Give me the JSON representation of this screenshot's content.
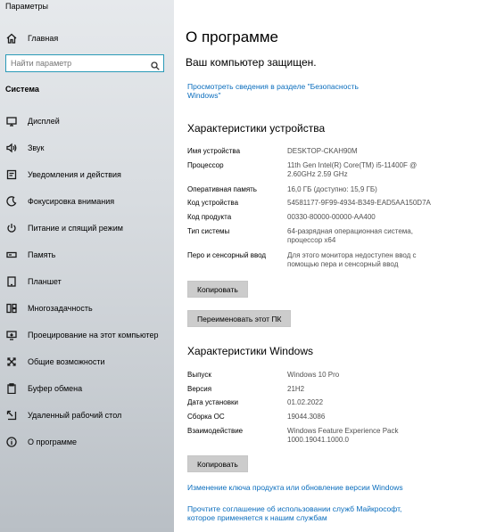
{
  "window": {
    "title": "Параметры"
  },
  "sidebar": {
    "home_label": "Главная",
    "search_placeholder": "Найти параметр",
    "section_label": "Система",
    "items": [
      {
        "label": "Дисплей",
        "icon": "display-icon"
      },
      {
        "label": "Звук",
        "icon": "speaker-icon"
      },
      {
        "label": "Уведомления и действия",
        "icon": "notifications-icon"
      },
      {
        "label": "Фокусировка внимания",
        "icon": "focus-assist-icon"
      },
      {
        "label": "Питание и спящий режим",
        "icon": "power-icon"
      },
      {
        "label": "Память",
        "icon": "storage-icon"
      },
      {
        "label": "Планшет",
        "icon": "tablet-icon"
      },
      {
        "label": "Многозадачность",
        "icon": "multitasking-icon"
      },
      {
        "label": "Проецирование на этот компьютер",
        "icon": "projecting-icon"
      },
      {
        "label": "Общие возможности",
        "icon": "shared-experiences-icon"
      },
      {
        "label": "Буфер обмена",
        "icon": "clipboard-icon"
      },
      {
        "label": "Удаленный рабочий стол",
        "icon": "remote-desktop-icon"
      },
      {
        "label": "О программе",
        "icon": "info-icon"
      }
    ]
  },
  "main": {
    "page_title": "О программе",
    "protection_heading": "Ваш компьютер защищен.",
    "security_link": "Просмотреть сведения в разделе \"Безопасность Windows\"",
    "device_specs": {
      "heading": "Характеристики устройства",
      "rows": [
        {
          "key": "Имя устройства",
          "value": "DESKTOP-CKAH90M"
        },
        {
          "key": "Процессор",
          "value": "11th Gen Intel(R) Core(TM) i5-11400F @ 2.60GHz   2.59 GHz"
        },
        {
          "key": "Оперативная память",
          "value": "16,0 ГБ (доступно: 15,9 ГБ)"
        },
        {
          "key": "Код устройства",
          "value": "54581177-9F99-4934-B349-EAD5AA150D7A"
        },
        {
          "key": "Код продукта",
          "value": "00330-80000-00000-AA400"
        },
        {
          "key": "Тип системы",
          "value": "64-разрядная операционная система, процессор x64"
        },
        {
          "key": "Перо и сенсорный ввод",
          "value": "Для этого монитора недоступен ввод с помощью пера и сенсорный ввод"
        }
      ],
      "copy_button": "Копировать",
      "rename_button": "Переименовать этот ПК"
    },
    "windows_specs": {
      "heading": "Характеристики Windows",
      "rows": [
        {
          "key": "Выпуск",
          "value": "Windows 10 Pro"
        },
        {
          "key": "Версия",
          "value": "21H2"
        },
        {
          "key": "Дата установки",
          "value": "01.02.2022"
        },
        {
          "key": "Сборка ОС",
          "value": "19044.3086"
        },
        {
          "key": "Взаимодействие",
          "value": "Windows Feature Experience Pack 1000.19041.1000.0"
        }
      ],
      "copy_button": "Копировать"
    },
    "product_key_link": "Изменение ключа продукта или обновление версии Windows",
    "services_link": "Прочтите соглашение об использовании служб Майкрософт, которое применяется к нашим службам"
  },
  "colors": {
    "accent": "#0a6dbd",
    "search_border": "#2a9ab8",
    "button_bg": "#cccccc"
  }
}
